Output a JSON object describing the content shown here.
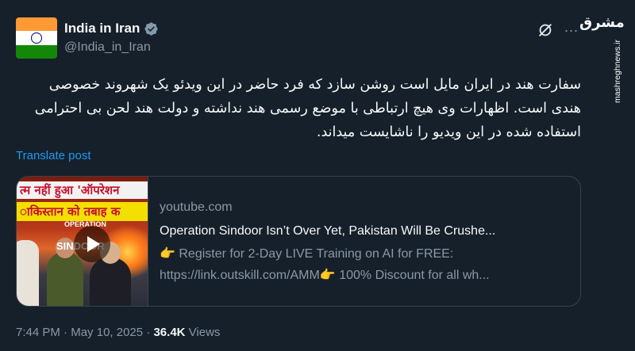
{
  "account": {
    "display_name": "India in Iran",
    "handle": "@India_in_Iran",
    "verified": true,
    "avatar_icon": "india-flag"
  },
  "toolbar": {
    "grok_icon": "slashed-circle-icon",
    "more_icon": "more-dots-icon",
    "more_label": "..."
  },
  "watermark": {
    "logo": "مشرق",
    "site": "mashreghnews.ir"
  },
  "tweet": {
    "text": "سفارت هند در ایران مایل است روشن سازد که فرد حاضر در این ویدئو یک شهروند خصوصی هندی است. اظهارات وی هیچ ارتباطی با موضع رسمی هند نداشته و دولت هند لحن بی احترامی استفاده شده در این ویدیو را ناشایست میداند.",
    "translate_label": "Translate post"
  },
  "link_card": {
    "domain": "youtube.com",
    "title": "Operation Sindoor Isn’t Over Yet, Pakistan Will Be Crushe...",
    "desc_line1": "👉 Register for 2-Day LIVE Training on AI for FREE:",
    "desc_line2": "https://link.outskill.com/AMM👉 100% Discount for all wh...",
    "thumb_headline1": "त्म नहीं हुआ 'ऑपरेशन",
    "thumb_headline2": "ाकिस्तान को तबाह क",
    "thumb_label_small": "OPERATION",
    "thumb_label_big": "SINDOOR"
  },
  "meta": {
    "time": "7:44 PM",
    "separator": "·",
    "date": "May 10, 2025",
    "views_count": "36.4K",
    "views_label": "Views"
  },
  "colors": {
    "background": "#15202b",
    "link_blue": "#1d9bf0",
    "muted": "#8b98a5",
    "verified_blue": "#1d9bf0"
  }
}
